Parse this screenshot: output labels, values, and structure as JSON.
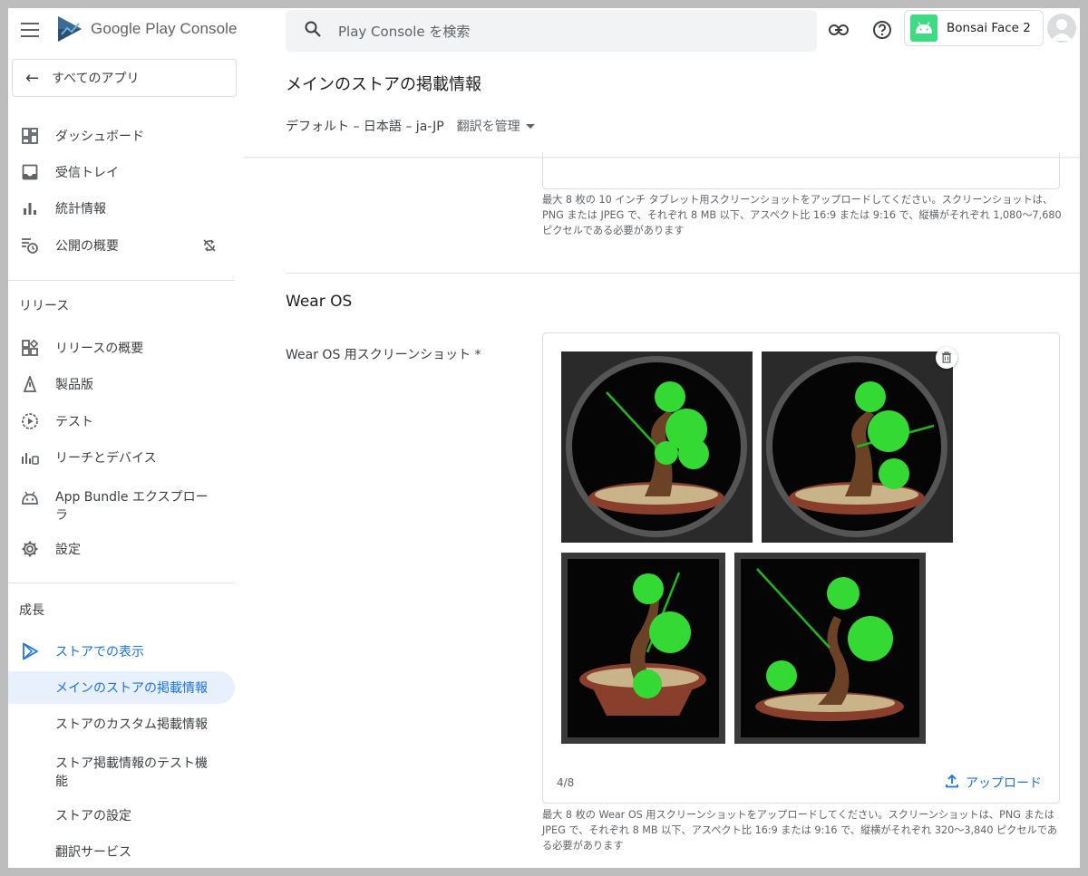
{
  "header": {
    "logo_text": "Google Play Console",
    "search_placeholder": "Play Console を検索",
    "app_name": "Bonsai Face 2"
  },
  "sidebar": {
    "all_apps": "すべてのアプリ",
    "items": [
      {
        "label": "ダッシュボード",
        "icon": "dashboard-icon"
      },
      {
        "label": "受信トレイ",
        "icon": "inbox-icon"
      },
      {
        "label": "統計情報",
        "icon": "bar-chart-icon"
      },
      {
        "label": "公開の概要",
        "icon": "publishing-overview-icon"
      }
    ],
    "release_heading": "リリース",
    "release_items": [
      {
        "label": "リリースの概要",
        "icon": "release-overview-icon"
      },
      {
        "label": "製品版",
        "icon": "production-icon"
      },
      {
        "label": "テスト",
        "icon": "testing-icon"
      },
      {
        "label": "リーチとデバイス",
        "icon": "reach-devices-icon"
      },
      {
        "label": "App Bundle エクスプローラ",
        "icon": "android-bundle-icon"
      },
      {
        "label": "設定",
        "icon": "gear-icon"
      }
    ],
    "grow_heading": "成長",
    "grow_items": [
      {
        "label": "ストアでの表示",
        "icon": "play-store-icon"
      },
      {
        "label": "メインのストアの掲載情報"
      },
      {
        "label": "ストアのカスタム掲載情報"
      },
      {
        "label": "ストア掲載情報のテスト機能"
      },
      {
        "label": "ストアの設定"
      },
      {
        "label": "翻訳サービス"
      }
    ]
  },
  "main": {
    "page_title": "メインのストアの掲載情報",
    "language": "デフォルト – 日本語 – ja-JP",
    "manage_translations": "翻訳を管理",
    "tablet_help": "最大 8 枚の 10 インチ タブレット用スクリーンショットをアップロードしてください。スクリーンショットは、PNG または JPEG で、それぞれ 8 MB 以下、アスペクト比 16:9 または 9:16 で、縦横がそれぞれ 1,080～7,680 ピクセルである必要があります",
    "wear_section_title": "Wear OS",
    "wear_field_label": "Wear OS 用スクリーンショット *",
    "shot_count": "4/8",
    "upload_label": "アップロード",
    "wear_help": "最大 8 枚の Wear OS 用スクリーンショットをアップロードしてください。スクリーンショットは、PNG または JPEG で、それぞれ 8 MB 以下、アスペクト比 16:9 または 9:16 で、縦横がそれぞれ 320～3,840 ピクセルである必要があります"
  },
  "colors": {
    "accent": "#1a73e8",
    "selected_bg": "#e8f0fe",
    "android_green": "#3ddc84",
    "bonsai_leaf": "#34d933",
    "bonsai_trunk": "#6b4226",
    "pot": "#8a3f2c"
  }
}
